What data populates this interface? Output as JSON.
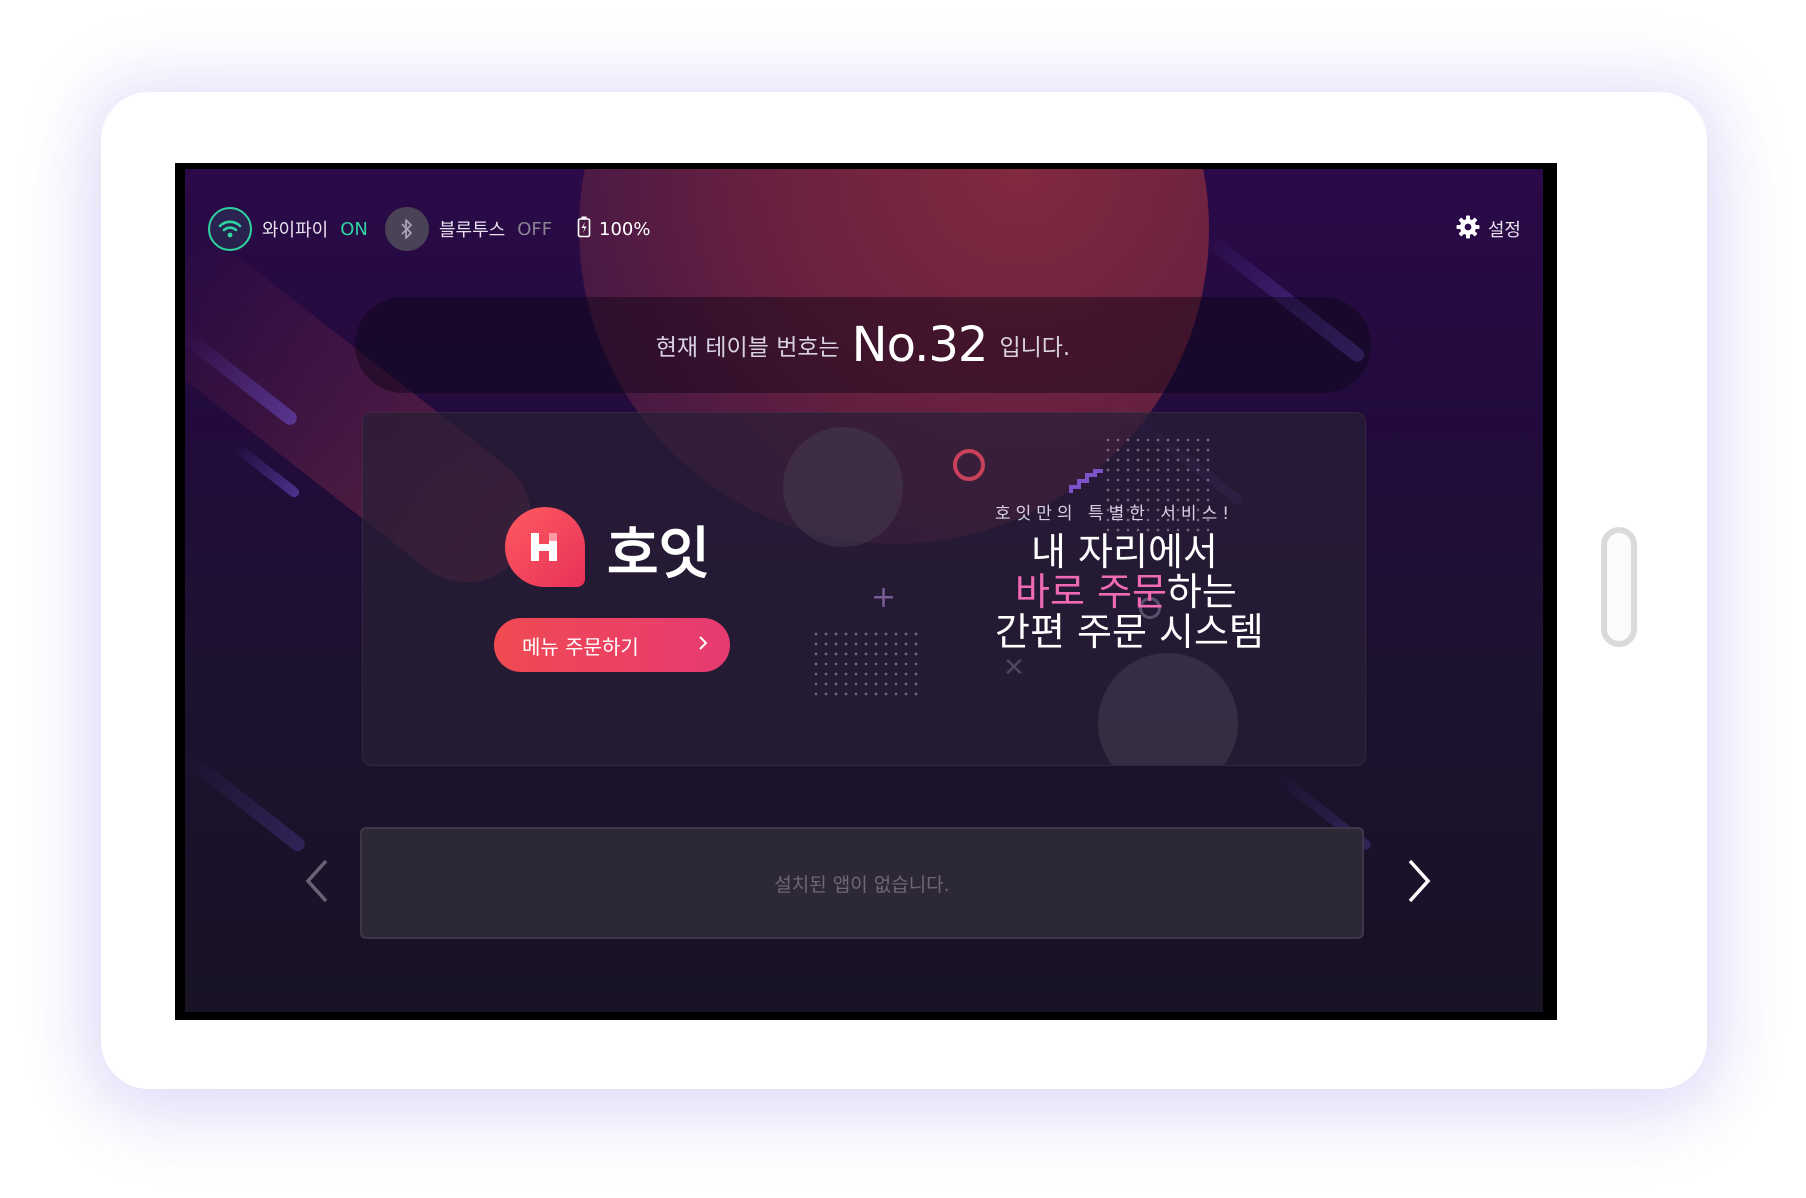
{
  "status_bar": {
    "wifi": {
      "label": "와이파이",
      "state": "ON",
      "icon": "wifi-icon",
      "color": "#2fd3a0"
    },
    "bluetooth": {
      "label": "블루투스",
      "state": "OFF",
      "icon": "bluetooth-icon"
    },
    "battery": {
      "value": "100%",
      "icon": "battery-charging-icon"
    },
    "settings": {
      "label": "설정",
      "icon": "gear-icon"
    }
  },
  "table_info": {
    "prefix": "현재 테이블 번호는",
    "number": "No.32",
    "suffix": "입니다."
  },
  "banner": {
    "brand": {
      "name": "호잇",
      "logo_letter": "H",
      "color": "#f04a52"
    },
    "order_button": {
      "label": "메뉴 주문하기",
      "icon": "chevron-right-icon"
    },
    "promo": {
      "tagline": "호잇만의 특별한 서비스!",
      "line1": "내 자리에서",
      "line2_highlight": "바로 주문",
      "line2_rest": "하는",
      "line3": "간편 주문 시스템",
      "highlight_color": "#f06ab4"
    }
  },
  "apps": {
    "empty_message": "설치된 앱이 없습니다.",
    "prev_icon": "chevron-left-icon",
    "next_icon": "chevron-right-icon"
  }
}
